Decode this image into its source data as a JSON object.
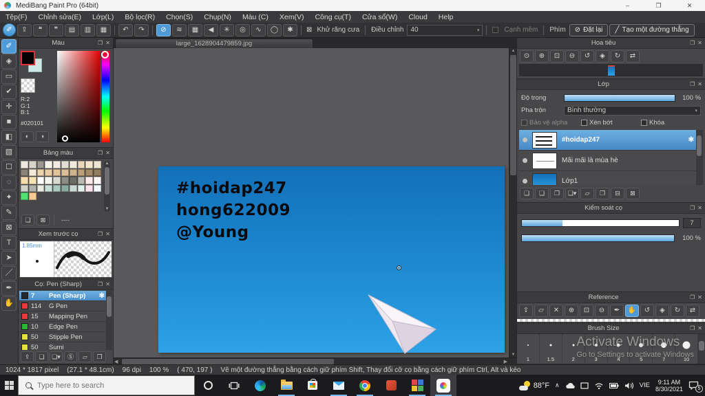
{
  "theme": {
    "accent": "#4f9bd8",
    "selection_blue": "#5b9fd6",
    "canvas_top": "#1270b8",
    "canvas_bottom": "#2ea2e6"
  },
  "icons": {
    "minimize": "–",
    "restore": "❐",
    "close": "✕",
    "popout": "❐",
    "panel_close": "✕",
    "caret_down": "▾",
    "gear": "✱",
    "antialias_box": "⊠",
    "reset_tool": "⊘",
    "line_tool": "╱"
  },
  "window": {
    "title": "MediBang Paint Pro (64bit)"
  },
  "menubar": {
    "items": [
      {
        "name": "menu-tep",
        "label": "Tệp(F)"
      },
      {
        "name": "menu-chinh-sua",
        "label": "Chỉnh sửa(E)"
      },
      {
        "name": "menu-lop",
        "label": "Lớp(L)"
      },
      {
        "name": "menu-bo-loc",
        "label": "Bộ lọc(R)"
      },
      {
        "name": "menu-chon",
        "label": "Chọn(S)"
      },
      {
        "name": "menu-chup",
        "label": "Chụp(N)"
      },
      {
        "name": "menu-mau",
        "label": "Màu (C)"
      },
      {
        "name": "menu-xem",
        "label": "Xem(V)"
      },
      {
        "name": "menu-cong-cu",
        "label": "Công cụ(T)"
      },
      {
        "name": "menu-cua-so",
        "label": "Cửa sổ(W)"
      },
      {
        "name": "menu-cloud",
        "label": "Cloud"
      },
      {
        "name": "menu-help",
        "label": "Help"
      }
    ]
  },
  "toolbar": {
    "group1": [
      {
        "name": "active-tool-indicator",
        "glyph": "✐",
        "selected": true,
        "round": true
      },
      {
        "name": "publish-button",
        "glyph": "⇪"
      },
      {
        "name": "comment-button",
        "glyph": "❝"
      },
      {
        "name": "chat-button",
        "glyph": "❞"
      },
      {
        "name": "document-button",
        "glyph": "▤"
      },
      {
        "name": "list-button",
        "glyph": "▥"
      },
      {
        "name": "canvas-settings-button",
        "glyph": "▦"
      }
    ],
    "group2": [
      {
        "name": "undo-button",
        "glyph": "↶"
      },
      {
        "name": "redo-button",
        "glyph": "↷"
      }
    ],
    "group3": [
      {
        "name": "no-snap-button",
        "glyph": "⊘",
        "selected": true
      },
      {
        "name": "parallel-snap-button",
        "glyph": "≋"
      },
      {
        "name": "grid-snap-button",
        "glyph": "▦"
      },
      {
        "name": "vanishing-snap-button",
        "glyph": "◀"
      },
      {
        "name": "radial-snap-button",
        "glyph": "✳"
      },
      {
        "name": "concentric-snap-button",
        "glyph": "◎"
      },
      {
        "name": "curve-snap-button",
        "glyph": "∿"
      },
      {
        "name": "ellipse-snap-button",
        "glyph": "◯"
      },
      {
        "name": "snap-settings-button",
        "glyph": "✱"
      }
    ],
    "antialias": "Khử răng cưa",
    "correction_label": "Điều chỉnh",
    "correction_value": "40",
    "soft_edge": "Cạnh mềm",
    "key_label": "Phím",
    "reset": "Đặt lại",
    "line": "Tạo một đường thẳng"
  },
  "tools": [
    {
      "name": "brush-tool",
      "glyph": "✐",
      "selected": true
    },
    {
      "name": "eraser-tool",
      "glyph": "◈"
    },
    {
      "name": "rect-tool",
      "glyph": "▭"
    },
    {
      "name": "control-point-tool",
      "glyph": "✔"
    },
    {
      "name": "move-tool",
      "glyph": "✛"
    },
    {
      "name": "fill-shape-tool",
      "glyph": "■"
    },
    {
      "name": "bucket-tool",
      "glyph": "◧"
    },
    {
      "name": "gradient-tool",
      "glyph": "▧"
    },
    {
      "name": "select-tool",
      "glyph": "☐"
    },
    {
      "name": "lasso-tool",
      "glyph": "◌"
    },
    {
      "name": "magic-wand-tool",
      "glyph": "✦"
    },
    {
      "name": "select-pen-tool",
      "glyph": "✎"
    },
    {
      "name": "select-eraser-tool",
      "glyph": "⊠"
    },
    {
      "name": "text-tool",
      "glyph": "T"
    },
    {
      "name": "operation-tool",
      "glyph": "➤"
    },
    {
      "name": "divide-tool",
      "glyph": "／"
    },
    {
      "name": "eyedropper-tool",
      "glyph": "✒"
    },
    {
      "name": "hand-tool",
      "glyph": "✋"
    }
  ],
  "panels": {
    "color": {
      "title": "Màu",
      "r": "R:2",
      "g": "G:1",
      "b": "B:1",
      "hex": "#020101",
      "buttons": [
        {
          "name": "color-wheel-button",
          "glyph": "◐"
        },
        {
          "name": "color-compare-button",
          "glyph": "◑"
        }
      ]
    },
    "palette": {
      "title": "Bảng màu",
      "note": "----",
      "toolbar": [
        {
          "name": "palette-add-button",
          "glyph": "❏"
        },
        {
          "name": "palette-delete-button",
          "glyph": "⊠"
        }
      ],
      "colors": [
        {
          "c": "#ebe7de"
        },
        {
          "c": "#d8d3c8"
        },
        {
          "c": "#9c978f"
        },
        {
          "c": "#f6f3eb"
        },
        {
          "c": "#f0eae0"
        },
        {
          "c": "#e4ded2"
        },
        {
          "c": "#f1ebdb"
        },
        {
          "c": "#ebd8bc"
        },
        {
          "c": "#f4e6cb"
        },
        {
          "c": "#eee6d5"
        },
        {
          "c": "#8c8276"
        },
        {
          "c": "#f4ead7"
        },
        {
          "c": "#ebd2ab"
        },
        {
          "c": "#e8cca3"
        },
        {
          "c": "#e2c39b"
        },
        {
          "c": "#dbbe98"
        },
        {
          "c": "#ceb38d"
        },
        {
          "c": "#bba07b"
        },
        {
          "c": "#a38967"
        },
        {
          "c": "#927d5f"
        },
        {
          "c": "#f7dbab"
        },
        {
          "c": "#f9e2b3"
        },
        {
          "c": "#ffffff"
        },
        {
          "c": "#f6f6f1"
        },
        {
          "c": "#dadad2"
        },
        {
          "c": "#8c8c84"
        },
        {
          "c": "#6c6c66"
        },
        {
          "c": "#bab9b2"
        },
        {
          "c": "#ffe9e9"
        },
        {
          "c": "#fff6f6"
        },
        {
          "c": "#d2d2ca"
        },
        {
          "c": "#b2b2aa"
        },
        {
          "c": "#eaeae2"
        },
        {
          "c": "#cadfd7"
        },
        {
          "c": "#aacabf"
        },
        {
          "c": "#8aaa9f"
        },
        {
          "c": "#cadad2"
        },
        {
          "c": "#e2f2ea"
        },
        {
          "c": "#ffe2ea"
        },
        {
          "c": "#f2faff"
        },
        {
          "c": "#51e171"
        },
        {
          "c": "#f6ca92"
        }
      ]
    },
    "preview": {
      "title": "Xem trước cọ",
      "size": "1.85mm"
    },
    "brushes": {
      "title": "Cọ: Pen (Sharp)",
      "items": [
        {
          "size": "7",
          "name": "Pen (Sharp)",
          "color": "#26282c",
          "selected": true
        },
        {
          "size": "114",
          "name": "G Pen",
          "color": "#e8393d"
        },
        {
          "size": "15",
          "name": "Mapping Pen",
          "color": "#e8393d"
        },
        {
          "size": "10",
          "name": "Edge Pen",
          "color": "#2ab633"
        },
        {
          "size": "50",
          "name": "Stipple Pen",
          "color": "#e5e23a"
        },
        {
          "size": "50",
          "name": "Sumi",
          "color": "#e5e23a"
        }
      ],
      "toolbar": [
        {
          "name": "brush-cloud-button",
          "glyph": "⇪"
        },
        {
          "name": "brush-add-button",
          "glyph": "❏"
        },
        {
          "name": "brush-add-menu-button",
          "glyph": "❏▾"
        },
        {
          "name": "brush-script-button",
          "glyph": "Ⓢ"
        },
        {
          "name": "brush-folder-button",
          "glyph": "▱"
        },
        {
          "name": "brush-duplicate-button",
          "glyph": "❐"
        }
      ]
    },
    "navigator": {
      "title": "Hoa tiêu",
      "icons": [
        {
          "name": "nav-zoom-reset-button",
          "glyph": "⊙"
        },
        {
          "name": "nav-zoom-in-button",
          "glyph": "⊕"
        },
        {
          "name": "nav-fit-button",
          "glyph": "⊡"
        },
        {
          "name": "nav-zoom-out-button",
          "glyph": "⊖"
        },
        {
          "name": "nav-rotate-ccw-button",
          "glyph": "↺"
        },
        {
          "name": "nav-rotate-reset-button",
          "glyph": "◈"
        },
        {
          "name": "nav-rotate-cw-button",
          "glyph": "↻"
        },
        {
          "name": "nav-flip-button",
          "glyph": "⇄"
        }
      ]
    },
    "layers": {
      "title": "Lớp",
      "opacity_label": "Độ trong",
      "opacity_value": "100 %",
      "blend_label": "Pha trộn",
      "blend_value": "Bình thường",
      "check_alpha": "Bảo vệ alpha",
      "check_clip": "Xén bớt",
      "check_lock": "Khóa",
      "items": [
        {
          "name": "#hoidap247",
          "selected": true
        },
        {
          "name": "Mãi mãi là mùa hè"
        },
        {
          "name": "Lớp1"
        }
      ],
      "toolbar": [
        {
          "name": "layer-add-button",
          "glyph": "❏"
        },
        {
          "name": "layer-add-halftone-button",
          "glyph": "❑"
        },
        {
          "name": "layer-add-1bit-button",
          "glyph": "❒"
        },
        {
          "name": "layer-add-menu-button",
          "glyph": "❏▾"
        },
        {
          "name": "layer-folder-button",
          "glyph": "▱"
        },
        {
          "name": "layer-duplicate-button",
          "glyph": "❐"
        },
        {
          "name": "layer-merge-button",
          "glyph": "⊟"
        },
        {
          "name": "layer-delete-button",
          "glyph": "⊠"
        }
      ]
    },
    "brushctl": {
      "title": "Kiểm soát cọ",
      "size_value": "7",
      "opacity_value": "100 %"
    },
    "reference": {
      "title": "Reference",
      "icons": [
        {
          "name": "ref-cloud-button",
          "glyph": "⇪"
        },
        {
          "name": "ref-open-button",
          "glyph": "▱"
        },
        {
          "name": "ref-close-button",
          "glyph": "✕"
        },
        {
          "name": "ref-zoom-in-button",
          "glyph": "⊕"
        },
        {
          "name": "ref-fit-button",
          "glyph": "⊡"
        },
        {
          "name": "ref-zoom-out-button",
          "glyph": "⊖"
        },
        {
          "name": "ref-eyedropper-button",
          "glyph": "✒"
        },
        {
          "name": "ref-hand-button",
          "glyph": "✋",
          "selected": true
        },
        {
          "name": "ref-rotate-ccw-button",
          "glyph": "↺"
        },
        {
          "name": "ref-rotate-reset-button",
          "glyph": "◈"
        },
        {
          "name": "ref-rotate-cw-button",
          "glyph": "↻"
        },
        {
          "name": "ref-flip-button",
          "glyph": "⇄"
        }
      ]
    },
    "brushsize": {
      "title": "Brush Size",
      "sizes": [
        {
          "label": "1",
          "dot": 2
        },
        {
          "label": "1.5",
          "dot": 3
        },
        {
          "label": "2",
          "dot": 3
        },
        {
          "label": "3",
          "dot": 4
        },
        {
          "label": "4",
          "dot": 5
        },
        {
          "label": "5",
          "dot": 6
        },
        {
          "label": "7",
          "dot": 8
        },
        {
          "label": "10",
          "dot": 11
        }
      ]
    }
  },
  "canvas": {
    "tab": "large_1628904479859.jpg",
    "lines": [
      "#hoidap247",
      "hong622009",
      "@Young"
    ]
  },
  "watermark": {
    "line1": "Activate Windows",
    "line2": "Go to Settings to activate Windows"
  },
  "statusbar": {
    "size": "1024 * 1817 pixel",
    "dims": "(27.1 * 48.1cm)",
    "dpi": "96 dpi",
    "zoom": "100 %",
    "coords": "( 470, 197 )",
    "hint": "Vẽ một đường thẳng bằng cách giữ phím Shift, Thay đổi cỡ cọ bằng cách giữ phím Ctrl, Alt và kéo"
  },
  "taskbar": {
    "search_placeholder": "Type here to search",
    "weather": "88°F",
    "language": "VIE",
    "time": "9:11 AM",
    "date": "8/30/2021",
    "badge": "5"
  }
}
